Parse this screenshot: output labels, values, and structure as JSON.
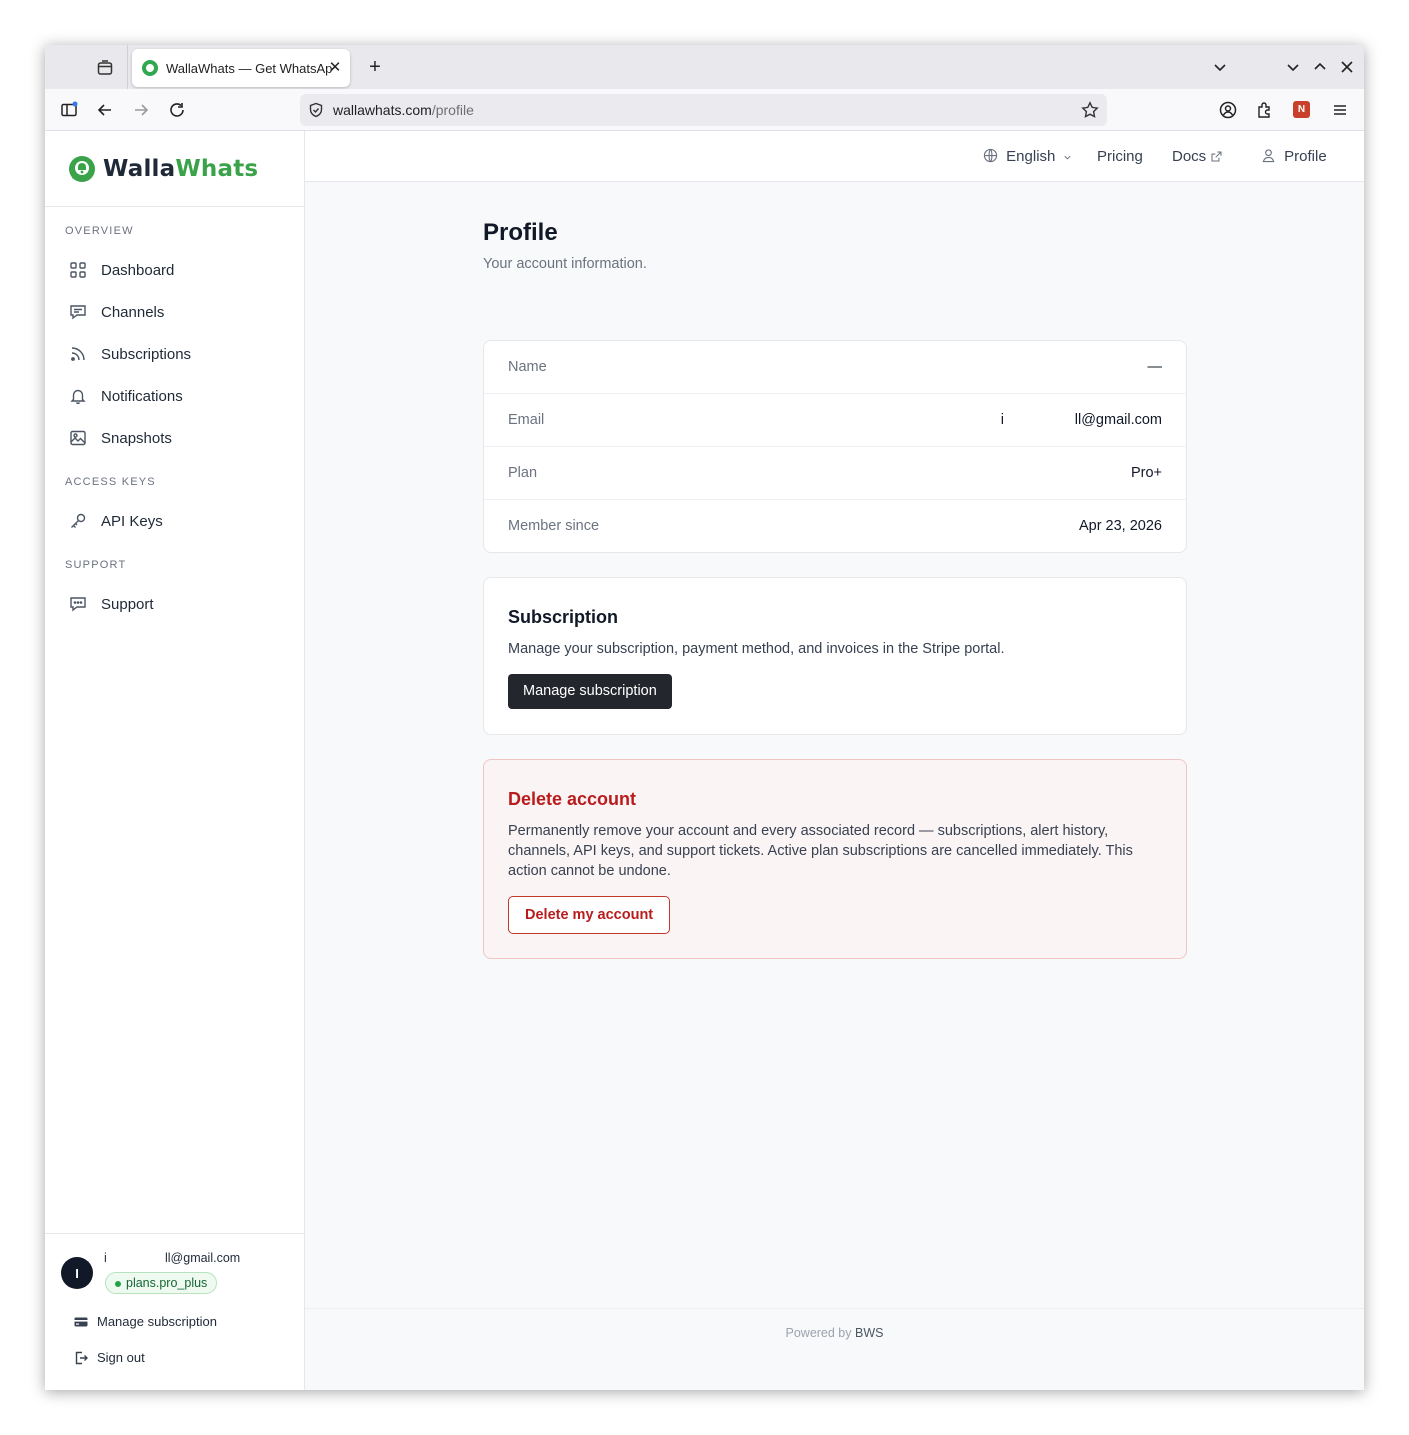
{
  "browser": {
    "tab_title": "WallaWhats — Get WhatsApp",
    "url_host": "wallawhats.com",
    "url_path": "/profile"
  },
  "brand": {
    "name_a": "Walla",
    "name_b": "Whats",
    "accent": "#3aa34a"
  },
  "sidebar": {
    "sections": [
      {
        "title": "OVERVIEW",
        "items": [
          {
            "label": "Dashboard",
            "icon": "grid-icon"
          },
          {
            "label": "Channels",
            "icon": "message-icon"
          },
          {
            "label": "Subscriptions",
            "icon": "rss-icon"
          },
          {
            "label": "Notifications",
            "icon": "bell-icon"
          },
          {
            "label": "Snapshots",
            "icon": "image-icon"
          }
        ]
      },
      {
        "title": "ACCESS KEYS",
        "items": [
          {
            "label": "API Keys",
            "icon": "key-icon"
          }
        ]
      },
      {
        "title": "SUPPORT",
        "items": [
          {
            "label": "Support",
            "icon": "chat-icon"
          }
        ]
      }
    ],
    "user": {
      "avatar_letter": "I",
      "email_a": "i",
      "email_b": "ll@gmail.com",
      "plan_badge": "plans.pro_plus"
    },
    "manage_subscription": "Manage subscription",
    "sign_out": "Sign out"
  },
  "topnav": {
    "language": "English",
    "pricing": "Pricing",
    "docs": "Docs",
    "profile": "Profile"
  },
  "page": {
    "title": "Profile",
    "subtitle": "Your account information."
  },
  "info": {
    "rows": [
      {
        "label": "Name",
        "value": "—"
      },
      {
        "label": "Email",
        "value_a": "i",
        "value_b": "ll@gmail.com"
      },
      {
        "label": "Plan",
        "value": "Pro+"
      },
      {
        "label": "Member since",
        "value": "Apr 23, 2026"
      }
    ]
  },
  "subscription": {
    "title": "Subscription",
    "text": "Manage your subscription, payment method, and invoices in the Stripe portal.",
    "button": "Manage subscription"
  },
  "delete": {
    "title": "Delete account",
    "text": "Permanently remove your account and every associated record — subscriptions, alert history, channels, API keys, and support tickets. Active plan subscriptions are cancelled immediately. This action cannot be undone.",
    "button": "Delete my account"
  },
  "footer": {
    "prefix": "Powered by",
    "brand": "BWS"
  }
}
